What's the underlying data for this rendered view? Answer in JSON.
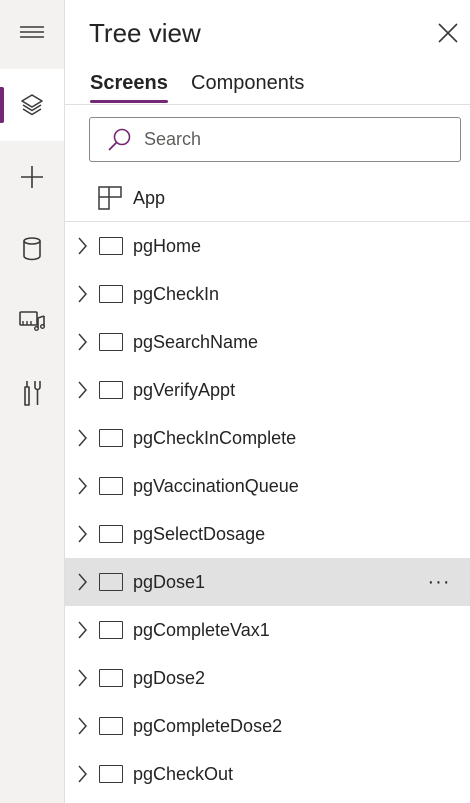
{
  "panel": {
    "title": "Tree view",
    "tabs": [
      {
        "label": "Screens",
        "active": true
      },
      {
        "label": "Components",
        "active": false
      }
    ],
    "search": {
      "placeholder": "Search",
      "value": ""
    },
    "app_label": "App"
  },
  "rail": {
    "icons": [
      "hamburger-menu-icon",
      "layers-icon",
      "plus-icon",
      "database-icon",
      "media-icon",
      "tools-icon"
    ],
    "active": "layers-icon"
  },
  "screens": [
    {
      "label": "pgHome"
    },
    {
      "label": "pgCheckIn"
    },
    {
      "label": "pgSearchName"
    },
    {
      "label": "pgVerifyAppt"
    },
    {
      "label": "pgCheckInComplete"
    },
    {
      "label": "pgVaccinationQueue"
    },
    {
      "label": "pgSelectDosage"
    },
    {
      "label": "pgDose1",
      "selected": true
    },
    {
      "label": "pgCompleteVax1"
    },
    {
      "label": "pgDose2"
    },
    {
      "label": "pgCompleteDose2"
    },
    {
      "label": "pgCheckOut"
    }
  ],
  "colors": {
    "accent": "#742774",
    "selected_row": "#e1e1e1",
    "rail_bg": "#f3f2f1"
  }
}
